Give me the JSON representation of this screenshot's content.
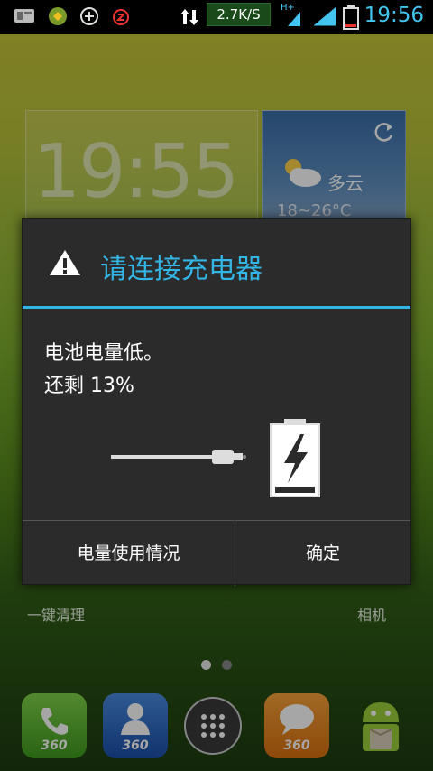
{
  "status_bar": {
    "network_speed": "2.7K/S",
    "network_type": "H+",
    "time": "19:56",
    "icons": [
      "sd-card-icon",
      "app-notification-icon",
      "plus-circle-icon",
      "alarm-icon",
      "data-transfer-icon",
      "signal-icon",
      "battery-icon"
    ]
  },
  "background": {
    "clock_widget": {
      "time": "19:55"
    },
    "weather_widget": {
      "condition": "多云",
      "temperature": "18~26°C",
      "icons": [
        "partly-cloudy-icon",
        "refresh-icon"
      ]
    },
    "labels": {
      "cleanup": "一键清理",
      "camera": "相机"
    },
    "page_indicator": {
      "pages": 2,
      "current": 1
    },
    "dock": [
      {
        "name": "phone-app-icon",
        "badge": "360",
        "color": "#5fb83a"
      },
      {
        "name": "contacts-app-icon",
        "badge": "360",
        "color": "#2a67c8"
      },
      {
        "name": "app-drawer-icon",
        "badge": "",
        "color": "#444444"
      },
      {
        "name": "messages-app-icon",
        "badge": "360",
        "color": "#f08a1a"
      },
      {
        "name": "android-store-icon",
        "badge": "",
        "color": "#8fc23a"
      }
    ]
  },
  "dialog": {
    "title": "请连接充电器",
    "title_color": "#33b5e5",
    "message_line1": "电池电量低。",
    "message_line2": "还剩 13%",
    "battery_level_percent": 13,
    "icons": [
      "warning-icon",
      "charger-plug-icon",
      "charging-battery-icon"
    ],
    "buttons": {
      "usage": "电量使用情况",
      "ok": "确定"
    }
  }
}
